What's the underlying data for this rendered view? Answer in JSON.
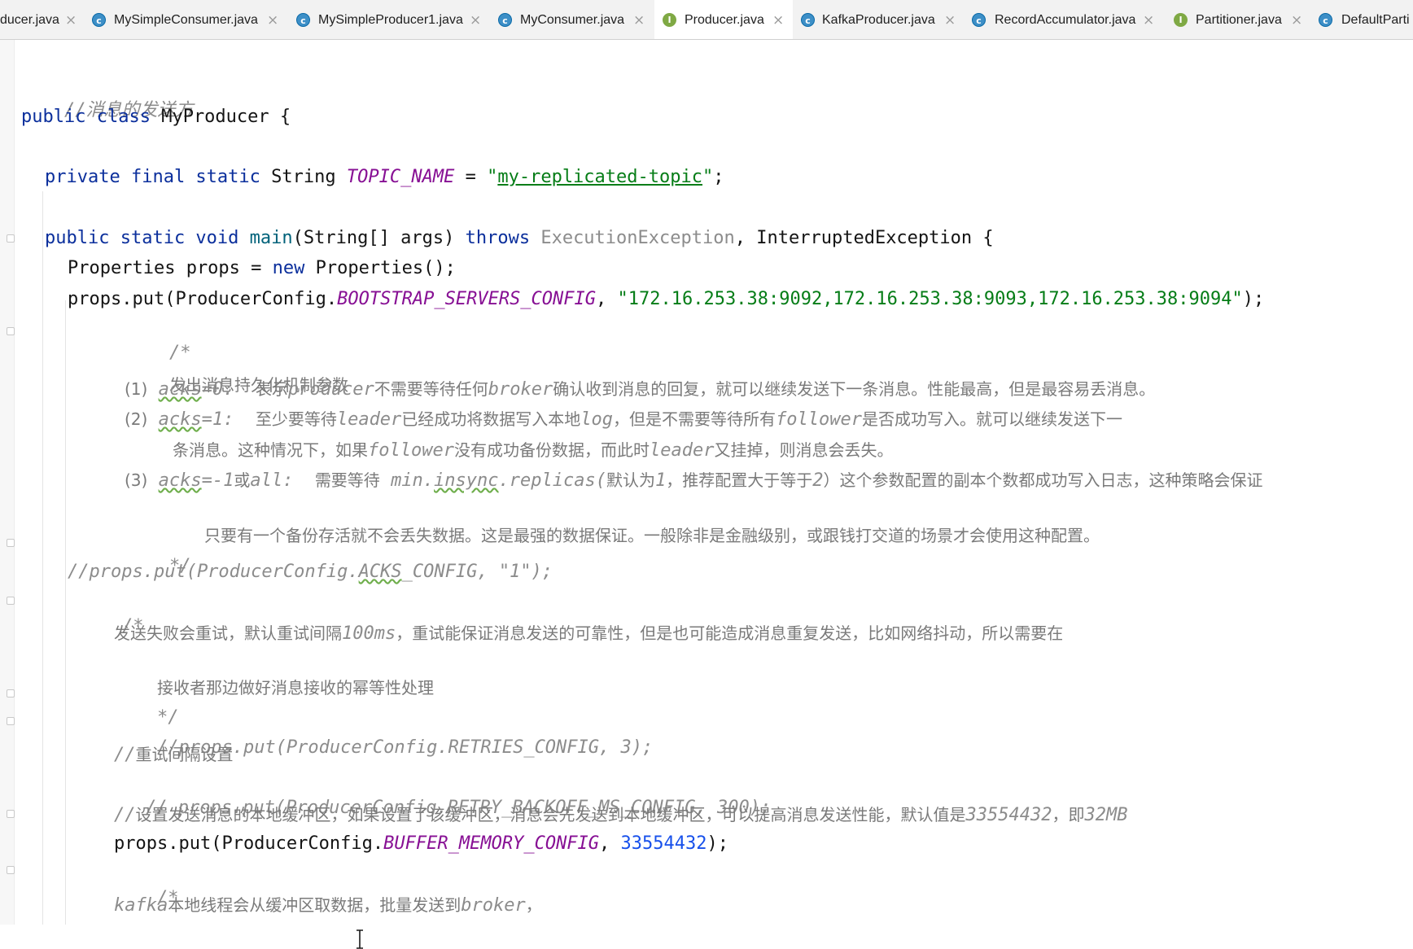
{
  "tabs": [
    {
      "label": "ducer.java",
      "kind": "none"
    },
    {
      "label": "MySimpleConsumer.java",
      "kind": "class"
    },
    {
      "label": "MySimpleProducer1.java",
      "kind": "class"
    },
    {
      "label": "MyConsumer.java",
      "kind": "class"
    },
    {
      "label": "Producer.java",
      "kind": "interface"
    },
    {
      "label": "KafkaProducer.java",
      "kind": "class"
    },
    {
      "label": "RecordAccumulator.java",
      "kind": "class"
    },
    {
      "label": "Partitioner.java",
      "kind": "interface"
    },
    {
      "label": "DefaultParti",
      "kind": "class"
    }
  ],
  "tab_close": "×",
  "icon_letters": {
    "class": "c",
    "interface": "I"
  },
  "code": {
    "l1": "//消息的发送方",
    "l2_kw": "public class",
    "l2_name": "MyProducer {",
    "l3_kw": "private final static",
    "l3_type": "String",
    "l3_const": "TOPIC_NAME",
    "l3_eq": "=",
    "l3_q1": "\"",
    "l3_str": "my-replicated-topic",
    "l3_q2": "\"",
    "l3_end": ";",
    "l4_kw": "public static void",
    "l4_fn": "main",
    "l4_params": "(String[] args)",
    "l4_throws": "throws",
    "l4_ex1": "ExecutionException",
    "l4_comma": ",",
    "l4_ex2": "InterruptedException {",
    "l5_a": "Properties props =",
    "l5_new": "new",
    "l5_b": "Properties();",
    "l6_a": "props.put(ProducerConfig.",
    "l6_const": "BOOTSTRAP_SERVERS_CONFIG",
    "l6_comma": ",",
    "l6_str": "\"172.16.253.38:9092,172.16.253.38:9093,172.16.253.38:9094\"",
    "l6_end": ");",
    "l7": "/*",
    "l8": "发出消息持久化机制参数",
    "l9_n": "(1)",
    "l9_acks": "acks",
    "l9_val": "=0:",
    "l9_t1": "表示",
    "l9_p": "producer",
    "l9_t2": "不需要等待任何",
    "l9_b": "broker",
    "l9_t3": "确认收到消息的回复，就可以继续发送下一条消息。性能最高，但是最容易丢消息。",
    "l10_n": "(2)",
    "l10_acks": "acks",
    "l10_val": "=1:",
    "l10_t1": "至少要等待",
    "l10_leader": "leader",
    "l10_t2": "已经成功将数据写入本地",
    "l10_log": "log",
    "l10_t3": "，但是不需要等待所有",
    "l10_f": "follower",
    "l10_t4": "是否成功写入。就可以继续发送下一",
    "l11_t1": "条消息。这种情况下，如果",
    "l11_f": "follower",
    "l11_t2": "没有成功备份数据，而此时",
    "l11_leader": "leader",
    "l11_t3": "又挂掉，则消息会丢失。",
    "l12_n": "(3)",
    "l12_acks": "acks",
    "l12_val": "=-1",
    "l12_t1": "或",
    "l12_all": "all:",
    "l12_t2": "需要等待",
    "l12_min": "min.",
    "l12_insync": "insync",
    "l12_rep": ".replicas(",
    "l12_t3": "默认为",
    "l12_one": "1",
    "l12_t4": "，推荐配置大于等于",
    "l12_two": "2",
    "l12_t5": "）这个参数配置的副本个数都成功写入日志，这种策略会保证",
    "l13": "只要有一个备份存活就不会丢失数据。这是最强的数据保证。一般除非是金融级别，或跟钱打交道的场景才会使用这种配置。",
    "l14": "*/",
    "l15_a": "//props.put(ProducerConfig.",
    "l15_acks": "ACKS",
    "l15_b": "_CONFIG, \"1\");",
    "l16": "/*",
    "l17_t1": "发送失败会重试，默认重试间隔",
    "l17_ms": "100ms",
    "l17_t2": "，重试能保证消息发送的可靠性，但是也可能造成消息重复发送，比如网络抖动，所以需要在",
    "l18": "接收者那边做好消息接收的幂等性处理",
    "l19": "*/",
    "l20": "//props.put(ProducerConfig.RETRIES_CONFIG, 3);",
    "l21_a": "//",
    "l21_t": "重试间隔设置",
    "l22": "// props.put(ProducerConfig.RETRY_BACKOFF_MS_CONFIG, 300);",
    "l23_a": "//",
    "l23_t1": "设置发送消息的本地缓冲区，如果设置了该缓冲区，消息会先发送到本地缓冲区，可以提高消息发送性能，默认值是",
    "l23_num": "33554432",
    "l23_t2": "，即",
    "l23_mb": "32MB",
    "l24_a": "props.put(ProducerConfig.",
    "l24_const": "BUFFER_MEMORY_CONFIG",
    "l24_comma": ",",
    "l24_num": "33554432",
    "l24_end": ");",
    "l25": "/*",
    "l26_k": "kafka",
    "l26_t1": "本地线程会从缓冲区取数据，批量发送到",
    "l26_b": "broker",
    "l26_t2": "，"
  }
}
